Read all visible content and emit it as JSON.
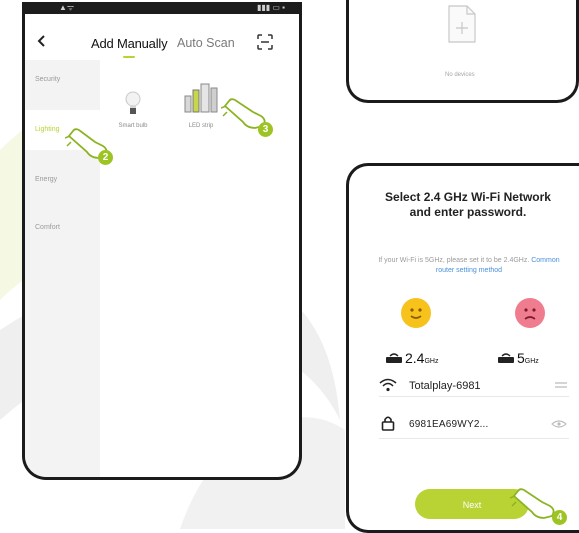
{
  "phone1": {
    "nav": {
      "tab_manual": "Add Manually",
      "tab_scan": "Auto Scan"
    },
    "sidebar": [
      {
        "label": "Security",
        "active": false
      },
      {
        "label": "Lighting",
        "active": true
      },
      {
        "label": "Energy",
        "active": false
      },
      {
        "label": "Comfort",
        "active": false
      }
    ],
    "devices": [
      {
        "label": "Smart bulb",
        "icon": "bulb-icon"
      },
      {
        "label": "LED strip",
        "icon": "led-strip-icon"
      }
    ]
  },
  "phone2": {
    "empty_label": "No devices"
  },
  "phone3": {
    "title": "Select 2.4 GHz Wi-Fi Network and enter password.",
    "note_prefix": "If your Wi-Fi is 5GHz, please set it to be 2.4GHz.",
    "note_link": "Common router setting method",
    "band_24": "2.4",
    "band_24_unit": "GHz",
    "band_5": "5",
    "band_5_unit": "GHz",
    "ssid": "Totalplay-6981",
    "password": "6981EA69WY2...",
    "next_label": "Next"
  },
  "steps": [
    "2",
    "3",
    "4"
  ],
  "colors": {
    "accent": "#b9d334",
    "badge": "#9ec424",
    "smile_ok": "#f6c21b",
    "smile_bad": "#f07c8f"
  }
}
